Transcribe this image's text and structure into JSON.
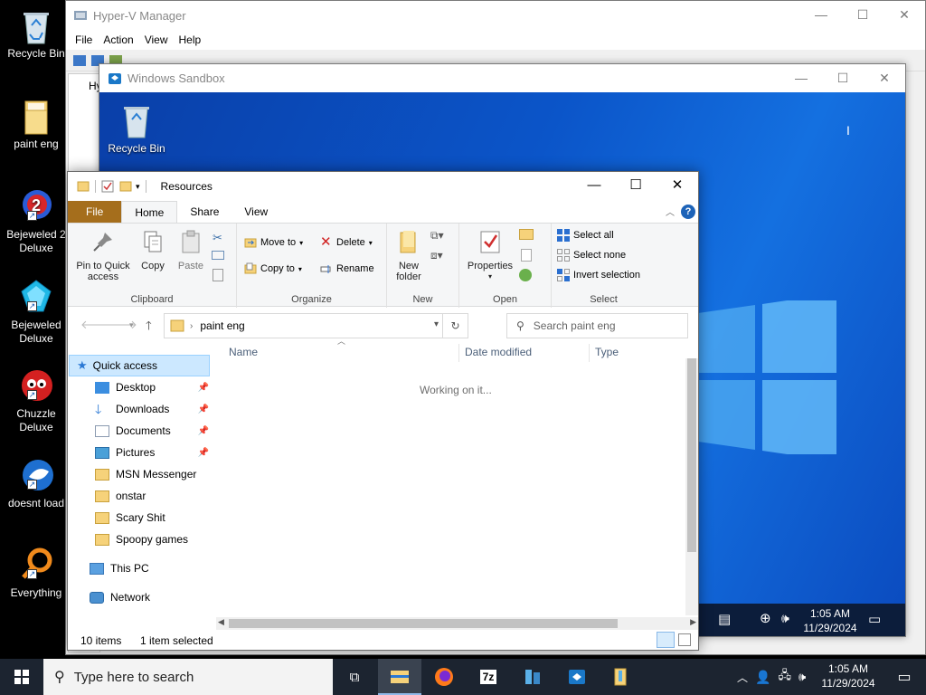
{
  "host_desktop": {
    "icons": [
      {
        "label": "Recycle Bin"
      },
      {
        "label": "paint eng"
      },
      {
        "label": "Bejeweled 2 Deluxe"
      },
      {
        "label": "Bejeweled Deluxe"
      },
      {
        "label": "Chuzzle Deluxe"
      },
      {
        "label": "doesnt load"
      },
      {
        "label": "Everything"
      }
    ]
  },
  "hyperv": {
    "title": "Hyper-V Manager",
    "menu": [
      "File",
      "Action",
      "View",
      "Help"
    ],
    "tree_label": "Hy"
  },
  "sandbox": {
    "title": "Windows Sandbox",
    "desktop_icon": "Recycle Bin",
    "clock_time": "1:05 AM",
    "clock_date": "11/29/2024"
  },
  "explorer": {
    "title": "Resources",
    "tabs": {
      "file": "File",
      "home": "Home",
      "share": "Share",
      "view": "View"
    },
    "clipboard": {
      "pin": "Pin to Quick access",
      "copy": "Copy",
      "paste": "Paste",
      "label": "Clipboard"
    },
    "organize": {
      "move_to": "Move to",
      "copy_to": "Copy to",
      "delete": "Delete",
      "rename": "Rename",
      "label": "Organize"
    },
    "new": {
      "new_folder": "New folder",
      "label": "New"
    },
    "open": {
      "properties": "Properties",
      "label": "Open"
    },
    "select": {
      "select_all": "Select all",
      "select_none": "Select none",
      "invert": "Invert selection",
      "label": "Select"
    },
    "address": {
      "path": "paint eng"
    },
    "search": {
      "placeholder": "Search paint eng"
    },
    "nav": {
      "quick_access": "Quick access",
      "items": [
        {
          "label": "Desktop",
          "pinned": true
        },
        {
          "label": "Downloads",
          "pinned": true
        },
        {
          "label": "Documents",
          "pinned": true
        },
        {
          "label": "Pictures",
          "pinned": true
        },
        {
          "label": "MSN Messenger",
          "pinned": false
        },
        {
          "label": "onstar",
          "pinned": false
        },
        {
          "label": "Scary Shit",
          "pinned": false
        },
        {
          "label": "Spoopy games",
          "pinned": false
        }
      ],
      "this_pc": "This PC",
      "network": "Network"
    },
    "columns": {
      "name": "Name",
      "date": "Date modified",
      "type": "Type"
    },
    "working": "Working on it...",
    "status": {
      "count": "10 items",
      "selected": "1 item selected"
    }
  },
  "taskbar": {
    "search_placeholder": "Type here to search",
    "time": "1:05 AM",
    "date": "11/29/2024"
  }
}
